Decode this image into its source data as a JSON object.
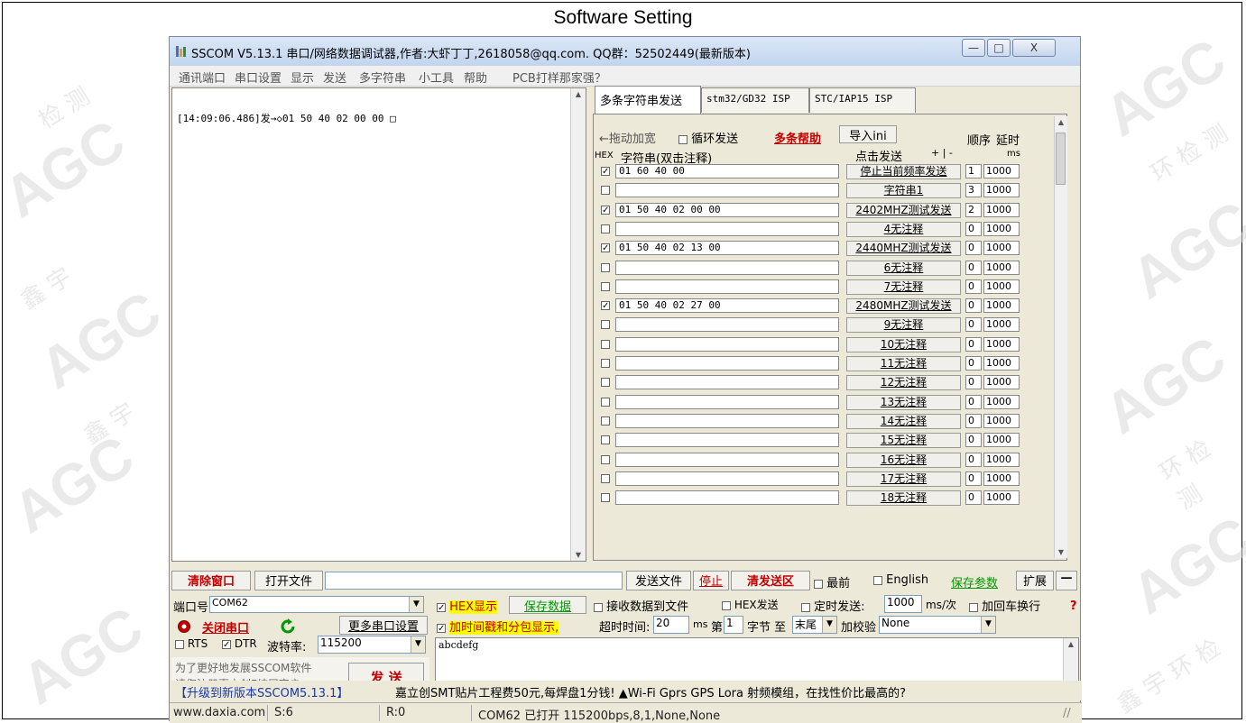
{
  "page_title": "Software Setting",
  "window": {
    "title": "SSCOM V5.13.1 串口/网络数据调试器,作者:大虾丁丁,2618058@qq.com. QQ群：52502449(最新版本)",
    "minimize_label": "—",
    "maximize_label": "□",
    "close_label": "X"
  },
  "menu": {
    "items": [
      "通讯端口",
      "串口设置",
      "显示",
      "发送",
      "多字符串",
      "小工具",
      "帮助",
      "PCB打样那家强？"
    ]
  },
  "receive": {
    "text": "[14:09:06.486]发→◇01 50 40 02 00 00 □"
  },
  "tabs": [
    "多条字符串发送",
    "stm32/GD32 ISP",
    "STC/IAP15 ISP"
  ],
  "multi": {
    "drag_label": "←拖动加宽",
    "loop_label": "循环发送",
    "help_label": "多条帮助",
    "import_label": "导入ini",
    "order_label": "顺序",
    "delay_label": "延时",
    "hex_label": "HEX",
    "string_header": "字符串(双击注释)",
    "click_send_label": "点击发送",
    "plus_minus": "+ | -",
    "ms_label": "ms",
    "rows": [
      {
        "checked": true,
        "data": "01 60 40 00",
        "button": "停止当前频率发送",
        "order": "1",
        "delay": "1000"
      },
      {
        "checked": false,
        "data": "",
        "button": "字符串1",
        "order": "3",
        "delay": "1000"
      },
      {
        "checked": true,
        "data": "01 50 40 02 00 00",
        "button": "2402MHZ测试发送",
        "order": "2",
        "delay": "1000"
      },
      {
        "checked": false,
        "data": "",
        "button": "4无注释",
        "order": "0",
        "delay": "1000"
      },
      {
        "checked": true,
        "data": "01 50 40 02 13 00",
        "button": "2440MHZ测试发送",
        "order": "0",
        "delay": "1000"
      },
      {
        "checked": false,
        "data": "",
        "button": "6无注释",
        "order": "0",
        "delay": "1000"
      },
      {
        "checked": false,
        "data": "",
        "button": "7无注释",
        "order": "0",
        "delay": "1000"
      },
      {
        "checked": true,
        "data": "01 50 40 02 27 00",
        "button": "2480MHZ测试发送",
        "order": "0",
        "delay": "1000"
      },
      {
        "checked": false,
        "data": "",
        "button": "9无注释",
        "order": "0",
        "delay": "1000"
      },
      {
        "checked": false,
        "data": "",
        "button": "10无注释",
        "order": "0",
        "delay": "1000"
      },
      {
        "checked": false,
        "data": "",
        "button": "11无注释",
        "order": "0",
        "delay": "1000"
      },
      {
        "checked": false,
        "data": "",
        "button": "12无注释",
        "order": "0",
        "delay": "1000"
      },
      {
        "checked": false,
        "data": "",
        "button": "13无注释",
        "order": "0",
        "delay": "1000"
      },
      {
        "checked": false,
        "data": "",
        "button": "14无注释",
        "order": "0",
        "delay": "1000"
      },
      {
        "checked": false,
        "data": "",
        "button": "15无注释",
        "order": "0",
        "delay": "1000"
      },
      {
        "checked": false,
        "data": "",
        "button": "16无注释",
        "order": "0",
        "delay": "1000"
      },
      {
        "checked": false,
        "data": "",
        "button": "17无注释",
        "order": "0",
        "delay": "1000"
      },
      {
        "checked": false,
        "data": "",
        "button": "18无注释",
        "order": "0",
        "delay": "1000"
      }
    ]
  },
  "toolbar": {
    "clear_window": "清除窗口",
    "open_file": "打开文件",
    "send_file": "发送文件",
    "stop": "停止",
    "clear_send": "清发送区",
    "topmost": "最前",
    "english": "English",
    "save_params": "保存参数",
    "expand": "扩展",
    "collapse": "—"
  },
  "port": {
    "port_label": "端口号",
    "port_value": "COM62",
    "close_port": "关闭串口",
    "more_settings": "更多串口设置",
    "rts_label": "RTS",
    "dtr_label": "DTR",
    "baud_label": "波特率:",
    "baud_value": "115200",
    "promo_line1": "为了更好地发展SSCOM软件",
    "promo_line2": "请您注册嘉立创F结尾客户",
    "send_button": "发 送"
  },
  "options": {
    "hex_display": "HEX显示",
    "save_data": "保存数据",
    "recv_to_file": "接收数据到文件",
    "hex_send": "HEX发送",
    "timed_send": "定时发送:",
    "timed_value": "1000",
    "timed_unit": "ms/次",
    "add_crlf": "加回车换行",
    "timestamp": "加时间戳和分包显示,",
    "timeout_label": "超时时间:",
    "timeout_value": "20",
    "timeout_unit": "ms",
    "byte_prefix": "第",
    "byte_value": "1",
    "byte_to": "字节 至",
    "tail_value": "末尾",
    "checksum_label": "加校验",
    "checksum_value": "None"
  },
  "send_text": "abcdefg",
  "upgrade_bar": {
    "upgrade": "【升级到新版本SSCOM5.13.1】",
    "ad": "嘉立创SMT贴片工程费50元,每焊盘1分钱! ▲Wi-Fi Gprs GPS Lora 射频模组，在找性价比最高的?"
  },
  "status": {
    "website": "www.daxia.com",
    "sent": "S:6",
    "received": "R:0",
    "port_status": "COM62 已打开  115200bps,8,1,None,None"
  },
  "colors": {
    "accent_red": "#c00000",
    "link_green": "#009900",
    "highlight_yellow": "#ffff00"
  }
}
